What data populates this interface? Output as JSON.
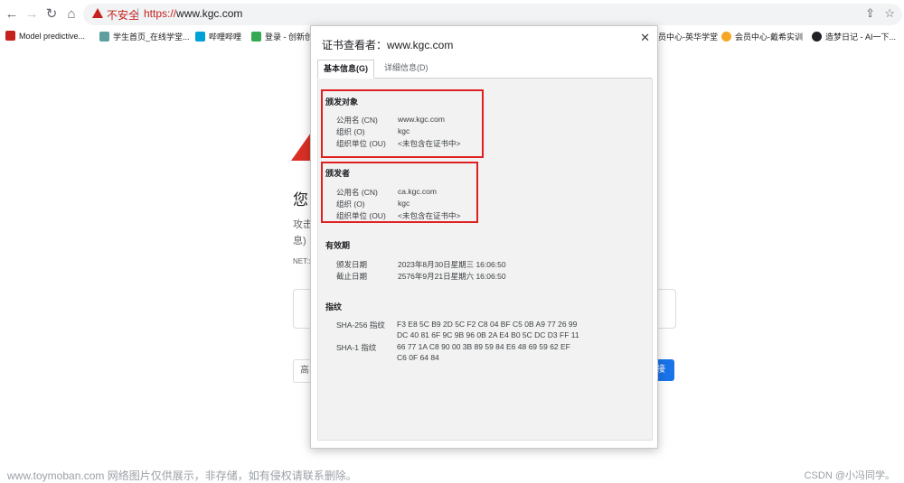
{
  "browser": {
    "insecure_label": "不安全",
    "url_scheme": "https://",
    "url_host": "www.kgc.com"
  },
  "bookmarks": [
    {
      "label": "Model predictive...",
      "color": "#c5221f"
    },
    {
      "label": "学生首页_在线学堂...",
      "color": "#5f9ea0"
    },
    {
      "label": "哔哩哔哩",
      "color": "#00a1d6"
    },
    {
      "label": "登录 - 创新创",
      "color": "#34a853"
    },
    {
      "label": "员中心-英华学堂",
      "color": "#4a90e2"
    },
    {
      "label": "会员中心-戴希实训",
      "color": "#f5a623"
    },
    {
      "label": "造梦日记 - AI一下...",
      "color": "#202124"
    }
  ],
  "background_page": {
    "heading": "您",
    "line1": "攻击",
    "line2": "息)",
    "net_label": "NET::",
    "left_button": "高",
    "right_button": "接"
  },
  "dialog": {
    "title": "证书查看者：www.kgc.com",
    "tabs": [
      "基本信息(G)",
      "详细信息(D)"
    ],
    "issued_to": {
      "title": "颁发对象",
      "rows": [
        {
          "label": "公用名 (CN)",
          "value": "www.kgc.com"
        },
        {
          "label": "组织 (O)",
          "value": "kgc"
        },
        {
          "label": "组织单位 (OU)",
          "value": "<未包含在证书中>"
        }
      ]
    },
    "issued_by": {
      "title": "颁发者",
      "rows": [
        {
          "label": "公用名 (CN)",
          "value": "ca.kgc.com"
        },
        {
          "label": "组织 (O)",
          "value": "kgc"
        },
        {
          "label": "组织单位 (OU)",
          "value": "<未包含在证书中>"
        }
      ]
    },
    "validity": {
      "title": "有效期",
      "rows": [
        {
          "label": "颁发日期",
          "value": "2023年8月30日星期三 16:06:50"
        },
        {
          "label": "截止日期",
          "value": "2576年9月21日星期六 16:06:50"
        }
      ]
    },
    "fingerprints": {
      "title": "指纹",
      "sha256_label": "SHA-256 指纹",
      "sha256_line1": "F3 E8 5C B9 2D 5C F2 C8 04 BF C5 0B A9 77 26 99",
      "sha256_line2": "DC 40 81 6F 9C 9B 96 0B 2A E4 B0 5C DC D3 FF 11",
      "sha1_label": "SHA-1 指纹",
      "sha1_line1": "66 77 1A C8 90 00 3B 89 59 84 E6 48 69 59 62 EF",
      "sha1_line2": "C6 0F 64 84"
    }
  },
  "footer": {
    "left": "www.toymoban.com 网络图片仅供展示，非存储，如有侵权请联系删除。",
    "right": "CSDN @小冯同学。"
  }
}
